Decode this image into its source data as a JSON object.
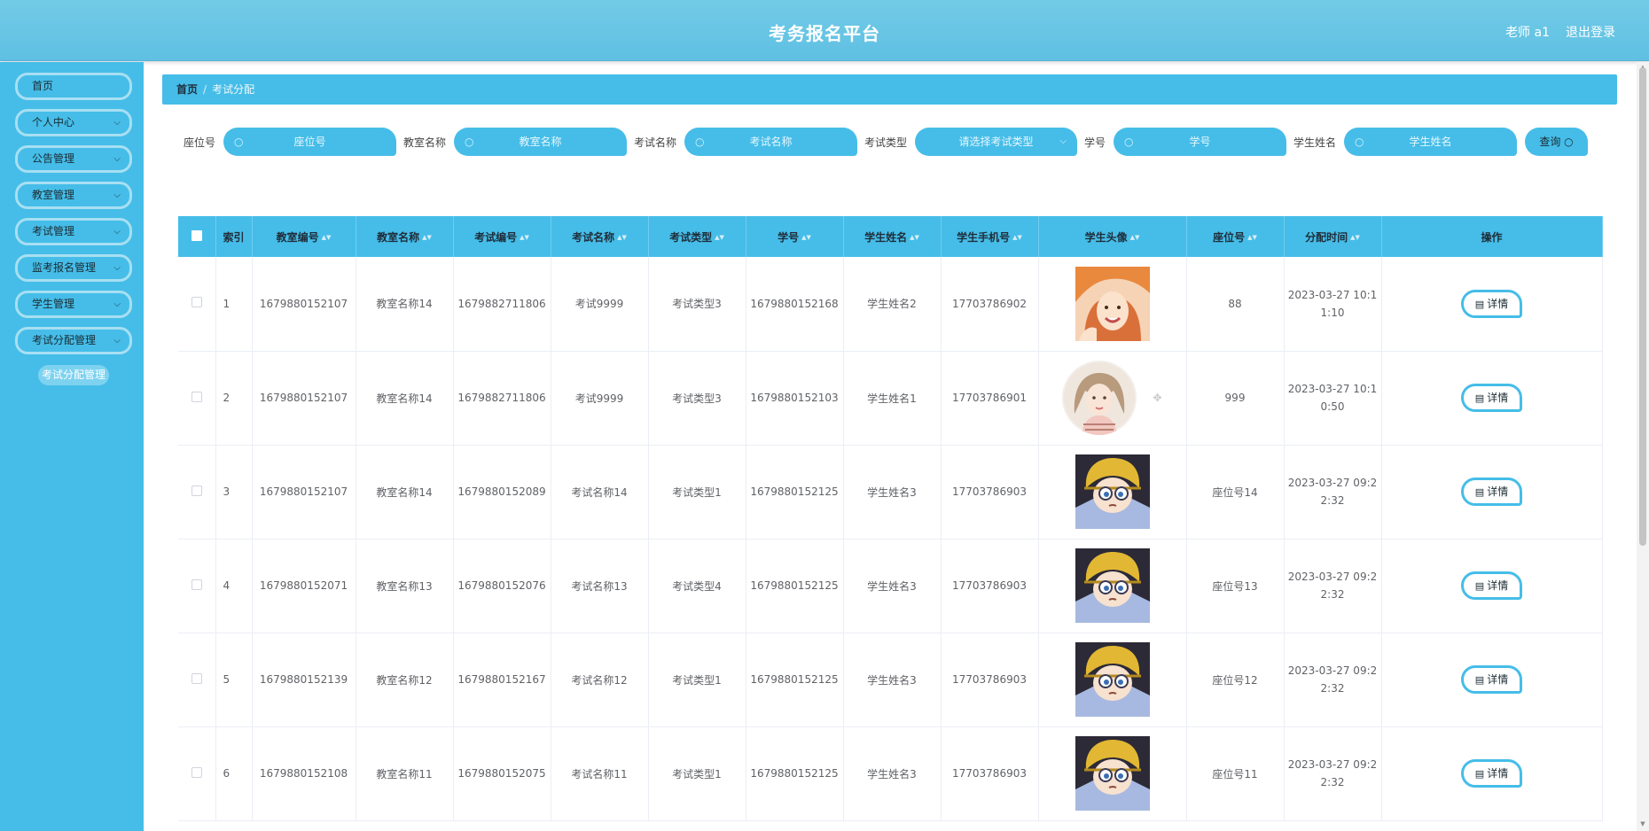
{
  "header": {
    "title": "考务报名平台",
    "user": "老师 a1",
    "logout": "退出登录"
  },
  "sidebar": {
    "items": [
      {
        "label": "首页",
        "has_chevron": false
      },
      {
        "label": "个人中心",
        "has_chevron": true
      },
      {
        "label": "公告管理",
        "has_chevron": true
      },
      {
        "label": "教室管理",
        "has_chevron": true
      },
      {
        "label": "考试管理",
        "has_chevron": true
      },
      {
        "label": "监考报名管理",
        "has_chevron": true
      },
      {
        "label": "学生管理",
        "has_chevron": true
      },
      {
        "label": "考试分配管理",
        "has_chevron": true
      }
    ],
    "sub_item": "考试分配管理"
  },
  "breadcrumb": {
    "home": "首页",
    "separator": "/",
    "current": "考试分配"
  },
  "search": {
    "fields": [
      {
        "label": "座位号",
        "placeholder": "座位号"
      },
      {
        "label": "教室名称",
        "placeholder": "教室名称"
      },
      {
        "label": "考试名称",
        "placeholder": "考试名称"
      },
      {
        "label": "考试类型",
        "placeholder": "请选择考试类型"
      },
      {
        "label": "学号",
        "placeholder": "学号"
      },
      {
        "label": "学生姓名",
        "placeholder": "学生姓名"
      }
    ],
    "query_label": "查询"
  },
  "table": {
    "headers": [
      "索引",
      "教室编号",
      "教室名称",
      "考试编号",
      "考试名称",
      "考试类型",
      "学号",
      "学生姓名",
      "学生手机号",
      "学生头像",
      "座位号",
      "分配时间",
      "操作"
    ],
    "detail_label": "详情",
    "rows": [
      {
        "index": "1",
        "room_no": "1679880152107",
        "room_name": "教室名称14",
        "exam_no": "1679882711806",
        "exam_name": "考试9999",
        "exam_type": "考试类型3",
        "student_no": "1679880152168",
        "student_name": "学生姓名2",
        "phone": "17703786902",
        "avatar": "avatar-girl-photo",
        "seat": "88",
        "time_a": "2023-03-27 10:1",
        "time_b": "1:10"
      },
      {
        "index": "2",
        "room_no": "1679880152107",
        "room_name": "教室名称14",
        "exam_no": "1679882711806",
        "exam_name": "考试9999",
        "exam_type": "考试类型3",
        "student_no": "1679880152103",
        "student_name": "学生姓名1",
        "phone": "17703786901",
        "avatar": "avatar-girl-drawing",
        "seat": "999",
        "time_a": "2023-03-27 10:1",
        "time_b": "0:50"
      },
      {
        "index": "3",
        "room_no": "1679880152107",
        "room_name": "教室名称14",
        "exam_no": "1679880152089",
        "exam_name": "考试名称14",
        "exam_type": "考试类型1",
        "student_no": "1679880152125",
        "student_name": "学生姓名3",
        "phone": "17703786903",
        "avatar": "avatar-boy-cartoon",
        "seat": "座位号14",
        "time_a": "2023-03-27 09:2",
        "time_b": "2:32"
      },
      {
        "index": "4",
        "room_no": "1679880152071",
        "room_name": "教室名称13",
        "exam_no": "1679880152076",
        "exam_name": "考试名称13",
        "exam_type": "考试类型4",
        "student_no": "1679880152125",
        "student_name": "学生姓名3",
        "phone": "17703786903",
        "avatar": "avatar-boy-cartoon",
        "seat": "座位号13",
        "time_a": "2023-03-27 09:2",
        "time_b": "2:32"
      },
      {
        "index": "5",
        "room_no": "1679880152139",
        "room_name": "教室名称12",
        "exam_no": "1679880152167",
        "exam_name": "考试名称12",
        "exam_type": "考试类型1",
        "student_no": "1679880152125",
        "student_name": "学生姓名3",
        "phone": "17703786903",
        "avatar": "avatar-boy-cartoon",
        "seat": "座位号12",
        "time_a": "2023-03-27 09:2",
        "time_b": "2:32"
      },
      {
        "index": "6",
        "room_no": "1679880152108",
        "room_name": "教室名称11",
        "exam_no": "1679880152075",
        "exam_name": "考试名称11",
        "exam_type": "考试类型1",
        "student_no": "1679880152125",
        "student_name": "学生姓名3",
        "phone": "17703786903",
        "avatar": "avatar-boy-cartoon",
        "seat": "座位号11",
        "time_a": "2023-03-27 09:2",
        "time_b": "2:32"
      }
    ]
  },
  "colors": {
    "primary": "#45bde8",
    "header": "#6fc9e6",
    "text": "#606266"
  }
}
